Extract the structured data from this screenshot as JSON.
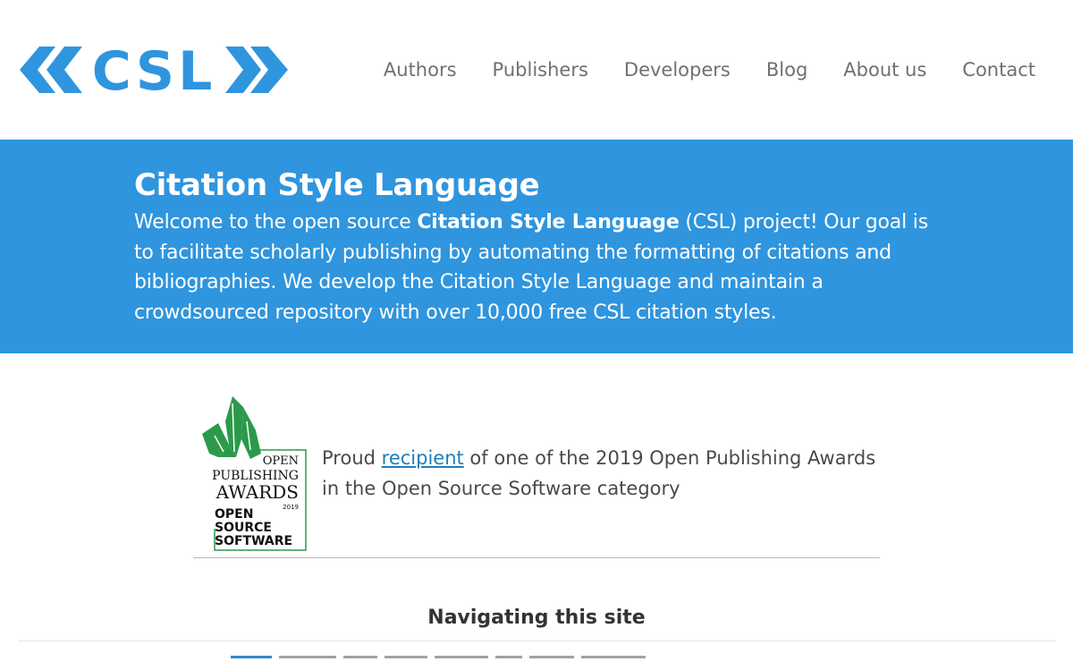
{
  "header": {
    "logo_text": "CSL",
    "nav": [
      {
        "label": "Authors"
      },
      {
        "label": "Publishers"
      },
      {
        "label": "Developers"
      },
      {
        "label": "Blog"
      },
      {
        "label": "About us"
      },
      {
        "label": "Contact"
      }
    ]
  },
  "hero": {
    "title": "Citation Style Language",
    "intro_before": "Welcome to the open source ",
    "intro_bold": "Citation Style Language",
    "intro_after": " (CSL) project! Our goal is to facilitate scholarly publishing by automating the formatting of citations and bibliographies. We develop the Citation Style Language and maintain a crowdsourced repository with over 10,000 free CSL citation styles."
  },
  "award": {
    "badge_lines": [
      "OPEN",
      "PUBLISHING",
      "AWARDS",
      "2019",
      "OPEN",
      "SOURCE",
      "SOFTWARE"
    ],
    "text_before": "Proud ",
    "link_label": "recipient",
    "text_after": " of one of the 2019 Open Publishing Awards in the Open Source Software category"
  },
  "navigating": {
    "heading": "Navigating this site"
  },
  "colors": {
    "brand_blue": "#2f95de",
    "nav_gray": "#707070",
    "link_blue": "#1f7dbd",
    "award_green": "#2a9a4a"
  }
}
